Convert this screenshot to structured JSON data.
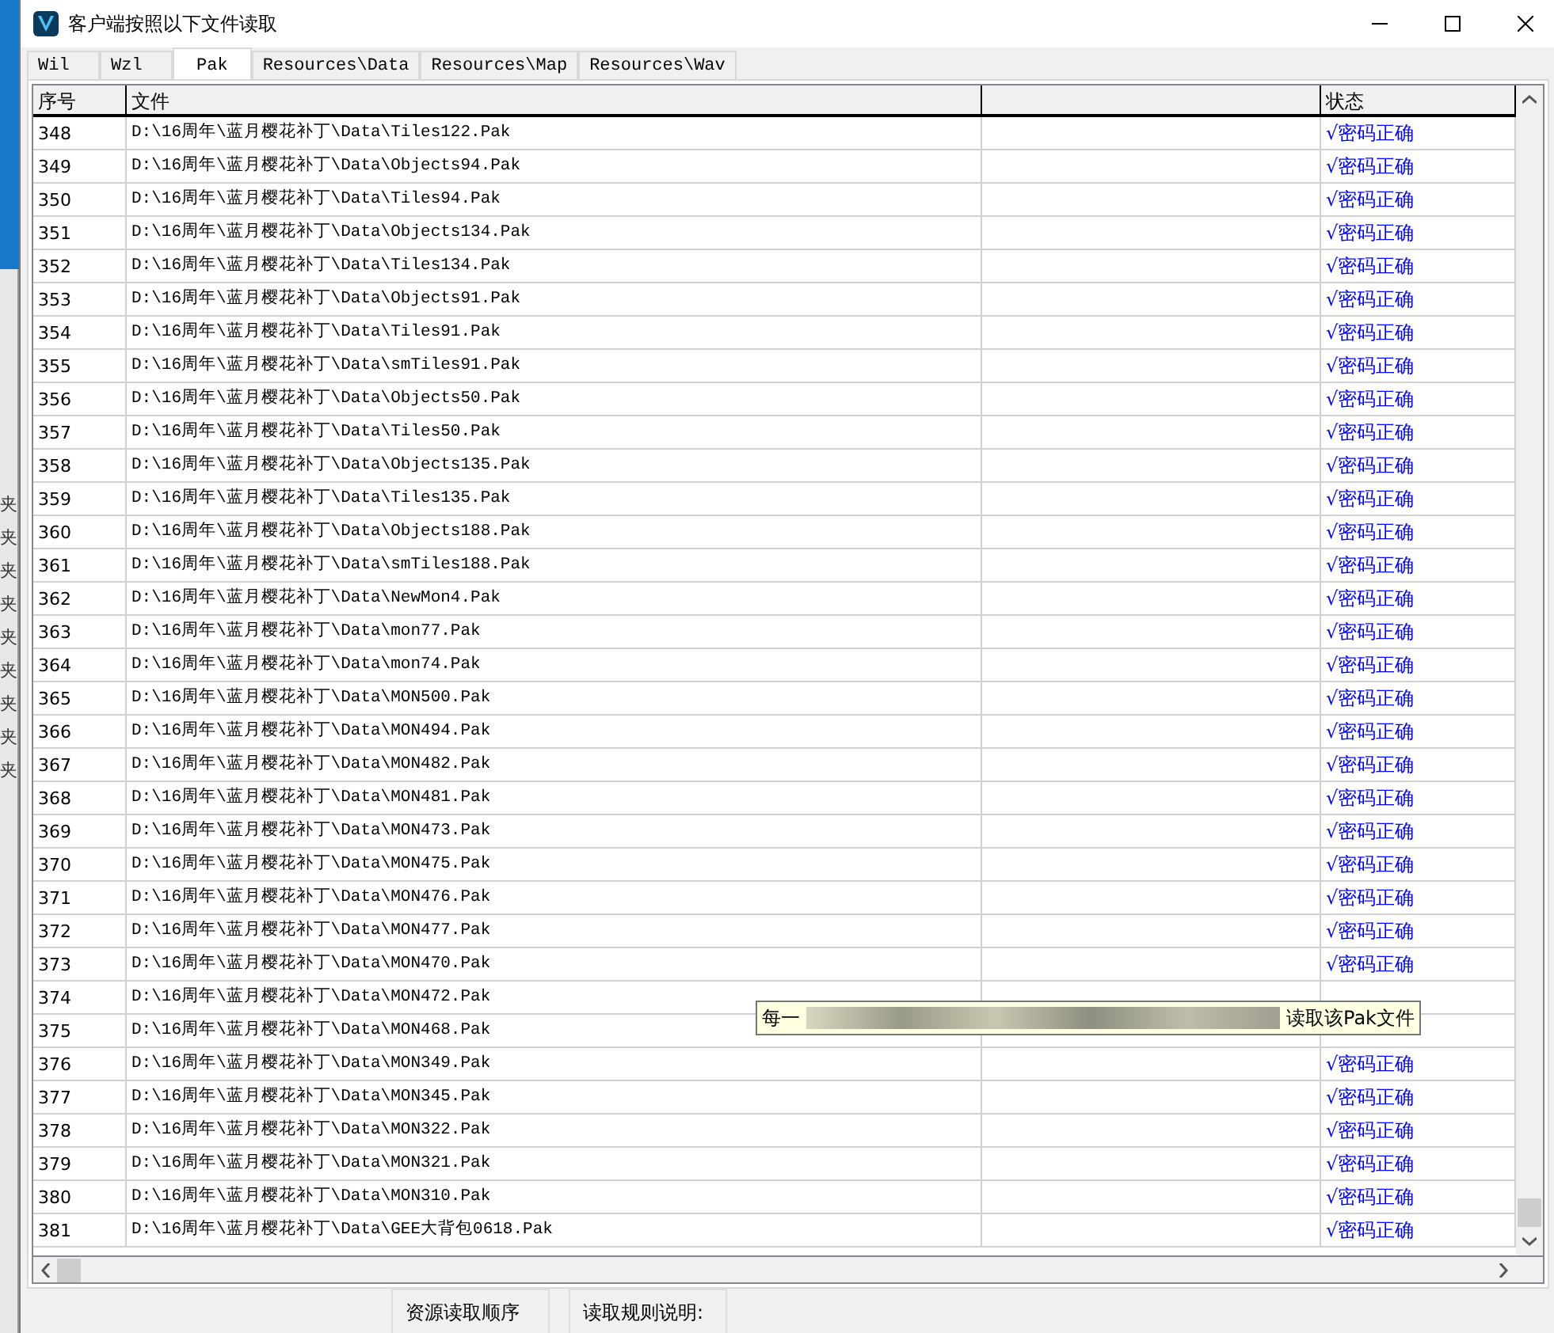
{
  "window": {
    "title": "客户端按照以下文件读取"
  },
  "tabs": [
    {
      "label": "Wil",
      "selected": false
    },
    {
      "label": "Wzl",
      "selected": false
    },
    {
      "label": "Pak",
      "selected": true
    },
    {
      "label": "Resources\\Data",
      "selected": false
    },
    {
      "label": "Resources\\Map",
      "selected": false
    },
    {
      "label": "Resources\\Wav",
      "selected": false
    }
  ],
  "background_window": {
    "labels": [
      "夹",
      "夹",
      "夹",
      "夹",
      "夹",
      "夹",
      "夹",
      "夹",
      "夹"
    ]
  },
  "table": {
    "columns": [
      "序号",
      "文件",
      "",
      "状态"
    ],
    "rows": [
      {
        "no": "348",
        "file": "D:\\16周年\\蓝月樱花补丁\\Data\\Tiles122.Pak",
        "status": "√密码正确"
      },
      {
        "no": "349",
        "file": "D:\\16周年\\蓝月樱花补丁\\Data\\Objects94.Pak",
        "status": "√密码正确"
      },
      {
        "no": "350",
        "file": "D:\\16周年\\蓝月樱花补丁\\Data\\Tiles94.Pak",
        "status": "√密码正确"
      },
      {
        "no": "351",
        "file": "D:\\16周年\\蓝月樱花补丁\\Data\\Objects134.Pak",
        "status": "√密码正确"
      },
      {
        "no": "352",
        "file": "D:\\16周年\\蓝月樱花补丁\\Data\\Tiles134.Pak",
        "status": "√密码正确"
      },
      {
        "no": "353",
        "file": "D:\\16周年\\蓝月樱花补丁\\Data\\Objects91.Pak",
        "status": "√密码正确"
      },
      {
        "no": "354",
        "file": "D:\\16周年\\蓝月樱花补丁\\Data\\Tiles91.Pak",
        "status": "√密码正确"
      },
      {
        "no": "355",
        "file": "D:\\16周年\\蓝月樱花补丁\\Data\\smTiles91.Pak",
        "status": "√密码正确"
      },
      {
        "no": "356",
        "file": "D:\\16周年\\蓝月樱花补丁\\Data\\Objects50.Pak",
        "status": "√密码正确"
      },
      {
        "no": "357",
        "file": "D:\\16周年\\蓝月樱花补丁\\Data\\Tiles50.Pak",
        "status": "√密码正确"
      },
      {
        "no": "358",
        "file": "D:\\16周年\\蓝月樱花补丁\\Data\\Objects135.Pak",
        "status": "√密码正确"
      },
      {
        "no": "359",
        "file": "D:\\16周年\\蓝月樱花补丁\\Data\\Tiles135.Pak",
        "status": "√密码正确"
      },
      {
        "no": "360",
        "file": "D:\\16周年\\蓝月樱花补丁\\Data\\Objects188.Pak",
        "status": "√密码正确"
      },
      {
        "no": "361",
        "file": "D:\\16周年\\蓝月樱花补丁\\Data\\smTiles188.Pak",
        "status": "√密码正确"
      },
      {
        "no": "362",
        "file": "D:\\16周年\\蓝月樱花补丁\\Data\\NewMon4.Pak",
        "status": "√密码正确"
      },
      {
        "no": "363",
        "file": "D:\\16周年\\蓝月樱花补丁\\Data\\mon77.Pak",
        "status": "√密码正确"
      },
      {
        "no": "364",
        "file": "D:\\16周年\\蓝月樱花补丁\\Data\\mon74.Pak",
        "status": "√密码正确"
      },
      {
        "no": "365",
        "file": "D:\\16周年\\蓝月樱花补丁\\Data\\MON500.Pak",
        "status": "√密码正确"
      },
      {
        "no": "366",
        "file": "D:\\16周年\\蓝月樱花补丁\\Data\\MON494.Pak",
        "status": "√密码正确"
      },
      {
        "no": "367",
        "file": "D:\\16周年\\蓝月樱花补丁\\Data\\MON482.Pak",
        "status": "√密码正确"
      },
      {
        "no": "368",
        "file": "D:\\16周年\\蓝月樱花补丁\\Data\\MON481.Pak",
        "status": "√密码正确"
      },
      {
        "no": "369",
        "file": "D:\\16周年\\蓝月樱花补丁\\Data\\MON473.Pak",
        "status": "√密码正确"
      },
      {
        "no": "370",
        "file": "D:\\16周年\\蓝月樱花补丁\\Data\\MON475.Pak",
        "status": "√密码正确"
      },
      {
        "no": "371",
        "file": "D:\\16周年\\蓝月樱花补丁\\Data\\MON476.Pak",
        "status": "√密码正确"
      },
      {
        "no": "372",
        "file": "D:\\16周年\\蓝月樱花补丁\\Data\\MON477.Pak",
        "status": "√密码正确"
      },
      {
        "no": "373",
        "file": "D:\\16周年\\蓝月樱花补丁\\Data\\MON470.Pak",
        "status": "√密码正确"
      },
      {
        "no": "374",
        "file": "D:\\16周年\\蓝月樱花补丁\\Data\\MON472.Pak",
        "status": ""
      },
      {
        "no": "375",
        "file": "D:\\16周年\\蓝月樱花补丁\\Data\\MON468.Pak",
        "status": ""
      },
      {
        "no": "376",
        "file": "D:\\16周年\\蓝月樱花补丁\\Data\\MON349.Pak",
        "status": "√密码正确"
      },
      {
        "no": "377",
        "file": "D:\\16周年\\蓝月樱花补丁\\Data\\MON345.Pak",
        "status": "√密码正确"
      },
      {
        "no": "378",
        "file": "D:\\16周年\\蓝月樱花补丁\\Data\\MON322.Pak",
        "status": "√密码正确"
      },
      {
        "no": "379",
        "file": "D:\\16周年\\蓝月樱花补丁\\Data\\MON321.Pak",
        "status": "√密码正确"
      },
      {
        "no": "380",
        "file": "D:\\16周年\\蓝月樱花补丁\\Data\\MON310.Pak",
        "status": "√密码正确"
      },
      {
        "no": "381",
        "file": "D:\\16周年\\蓝月樱花补丁\\Data\\GEE大背包0618.Pak",
        "status": "√密码正确"
      }
    ]
  },
  "tooltip": {
    "start": "每一",
    "end": "读取该Pak文件"
  },
  "footer": {
    "groups": [
      "资源读取顺序",
      "读取规则说明:"
    ]
  }
}
